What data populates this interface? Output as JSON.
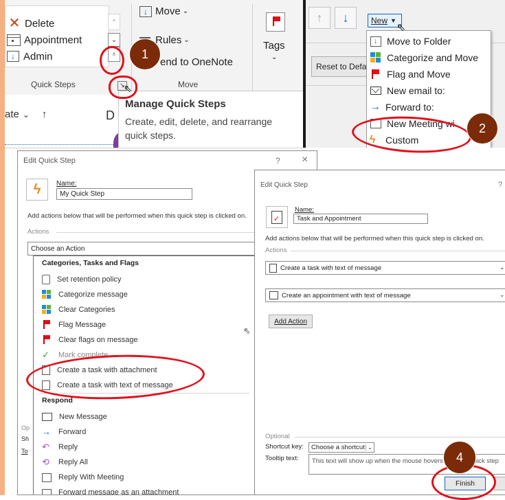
{
  "ribbon": {
    "quick_steps": {
      "items": [
        {
          "label": "Delete",
          "icon": "delete-x-icon"
        },
        {
          "label": "Appointment",
          "icon": "appointment-icon"
        },
        {
          "label": "Admin",
          "icon": "move-to-folder-icon"
        }
      ],
      "group_label": "Quick Steps"
    },
    "move": {
      "move_label": "Move",
      "rules_label": "Rules",
      "onenote_label": "Send to OneNote",
      "onenote_visible": "end to OneNote",
      "group_label": "Move"
    },
    "tags_label": "Tags"
  },
  "tooltip": {
    "title": "Manage Quick Steps",
    "body_line1": "Create, edit, delete, and rearrange",
    "body_line2": "quick steps."
  },
  "list_header": {
    "date_label": "ate",
    "from_initial": "D"
  },
  "new_menu": {
    "new_label": "New",
    "reset_label": "Reset to Defa",
    "items": [
      {
        "label": "Move to Folder",
        "icon": "move-to-folder-icon"
      },
      {
        "label": "Categorize and Move",
        "icon": "categorize-icon"
      },
      {
        "label": "Flag and Move",
        "icon": "flag-icon"
      },
      {
        "label": "New email to:",
        "icon": "mail-icon"
      },
      {
        "label": "Forward to:",
        "icon": "forward-arrow-icon"
      },
      {
        "label": "New Meeting wi",
        "icon": "meeting-icon"
      },
      {
        "label": "Custom",
        "icon": "lightning-icon"
      }
    ]
  },
  "dialog1": {
    "title": "Edit Quick Step",
    "help": "?",
    "close": "×",
    "name_label": "Name:",
    "name_value": "My Quick Step",
    "instruction": "Add actions below that will be performed when this quick step is clicked on.",
    "actions_label": "Actions",
    "choose_action": "Choose an Action",
    "optional_cut": "Op",
    "shortcut_cut": "Sh",
    "tooltip_cut": "To"
  },
  "action_menu": {
    "sections": [
      {
        "header": "Categories, Tasks and Flags",
        "items": [
          {
            "label": "Set retention policy",
            "icon": "retention-icon"
          },
          {
            "label": "Categorize message",
            "icon": "categorize-icon"
          },
          {
            "label": "Clear Categories",
            "icon": "categorize-icon"
          },
          {
            "label": "Flag Message",
            "icon": "flag-icon"
          },
          {
            "label": "Clear flags on message",
            "icon": "flag-icon"
          },
          {
            "label": "Mark complete",
            "icon": "checkmark-icon"
          },
          {
            "label": "Create a task with attachment",
            "icon": "task-clipboard-icon"
          },
          {
            "label": "Create a task with text of message",
            "icon": "task-clipboard-icon"
          }
        ]
      },
      {
        "header": "Respond",
        "items": [
          {
            "label": "New Message",
            "icon": "mail-icon"
          },
          {
            "label": "Forward",
            "icon": "forward-arrow-icon"
          },
          {
            "label": "Reply",
            "icon": "reply-icon"
          },
          {
            "label": "Reply All",
            "icon": "reply-all-icon"
          },
          {
            "label": "Reply With Meeting",
            "icon": "meeting-icon"
          },
          {
            "label": "Forward message as an attachment",
            "icon": "forward-attachment-icon"
          }
        ]
      }
    ]
  },
  "dialog2": {
    "title": "Edit Quick Step",
    "help": "?",
    "name_label": "Name:",
    "name_value": "Task and Appointment",
    "instruction": "Add actions below that will be performed when this quick step is clicked on.",
    "actions_label": "Actions",
    "action1": "Create a task with text of message",
    "action2": "Create an appointment with text of message",
    "add_action": "Add Action",
    "optional_label": "Optional",
    "shortcut_label": "Shortcut key:",
    "shortcut_value": "Choose a shortcut",
    "tooltip_label": "Tooltip text:",
    "tooltip_value": "This text will show up when the mouse hovers over the quick step",
    "finish": "Finish"
  },
  "badges": {
    "b1": "1",
    "b2": "2",
    "b4": "4"
  },
  "colors": {
    "accent_left": "#f4b183",
    "highlight_red": "#e0111b",
    "badge": "#7b2b08",
    "link_blue": "#1565c0"
  }
}
